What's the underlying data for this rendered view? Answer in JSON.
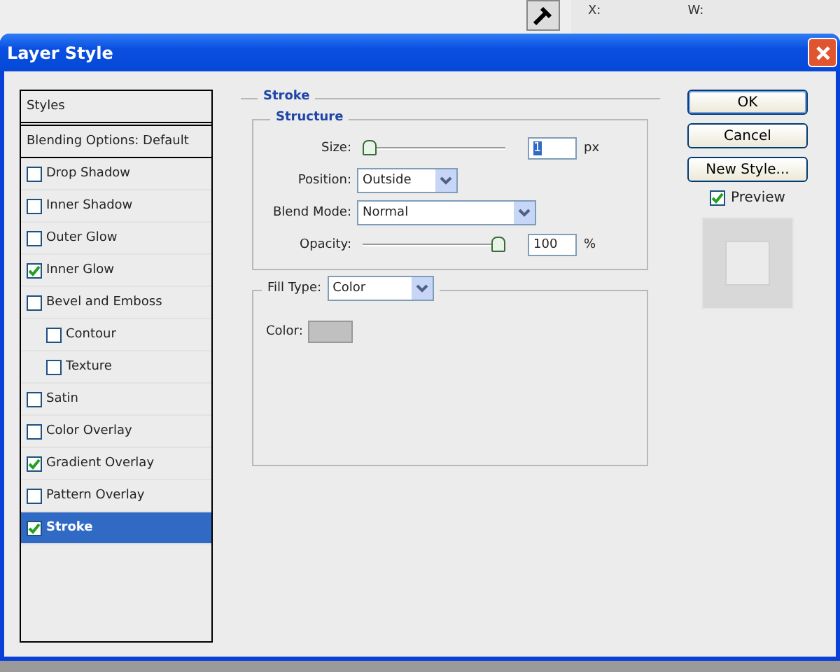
{
  "background_app": {
    "info_labels": [
      "X:",
      "W:"
    ]
  },
  "window": {
    "title": "Layer Style"
  },
  "styles_list": {
    "header": "Styles",
    "items": [
      {
        "label": "Blending Options: Default",
        "kind": "plain",
        "selected": false
      },
      {
        "label": "Drop Shadow",
        "kind": "check",
        "checked": false,
        "selected": false
      },
      {
        "label": "Inner Shadow",
        "kind": "check",
        "checked": false,
        "selected": false
      },
      {
        "label": "Outer Glow",
        "kind": "check",
        "checked": false,
        "selected": false
      },
      {
        "label": "Inner Glow",
        "kind": "check",
        "checked": true,
        "selected": false
      },
      {
        "label": "Bevel and Emboss",
        "kind": "check",
        "checked": false,
        "selected": false,
        "children": [
          {
            "label": "Contour",
            "kind": "check",
            "checked": false,
            "selected": false
          },
          {
            "label": "Texture",
            "kind": "check",
            "checked": false,
            "selected": false
          }
        ]
      },
      {
        "label": "Satin",
        "kind": "check",
        "checked": false,
        "selected": false
      },
      {
        "label": "Color Overlay",
        "kind": "check",
        "checked": false,
        "selected": false
      },
      {
        "label": "Gradient Overlay",
        "kind": "check",
        "checked": true,
        "selected": false
      },
      {
        "label": "Pattern Overlay",
        "kind": "check",
        "checked": false,
        "selected": false
      },
      {
        "label": "Stroke",
        "kind": "check",
        "checked": true,
        "selected": true
      }
    ]
  },
  "stroke": {
    "title": "Stroke",
    "structure": {
      "title": "Structure",
      "size": {
        "label": "Size:",
        "level": 0,
        "value": "1",
        "unit": "px"
      },
      "position": {
        "label": "Position:",
        "value": "Outside"
      },
      "blend_mode": {
        "label": "Blend Mode:",
        "value": "Normal"
      },
      "opacity": {
        "label": "Opacity:",
        "level": 1,
        "value": "100",
        "unit": "%"
      }
    },
    "fill_type": {
      "label": "Fill Type:",
      "value": "Color"
    },
    "fill_color": {
      "label": "Color:",
      "color": "#c0c0c0"
    }
  },
  "buttons": [
    {
      "label": "OK",
      "default": true
    },
    {
      "label": "Cancel",
      "default": false
    },
    {
      "label": "New Style...",
      "default": false
    }
  ],
  "preview": {
    "label": "Preview",
    "checked": true
  }
}
